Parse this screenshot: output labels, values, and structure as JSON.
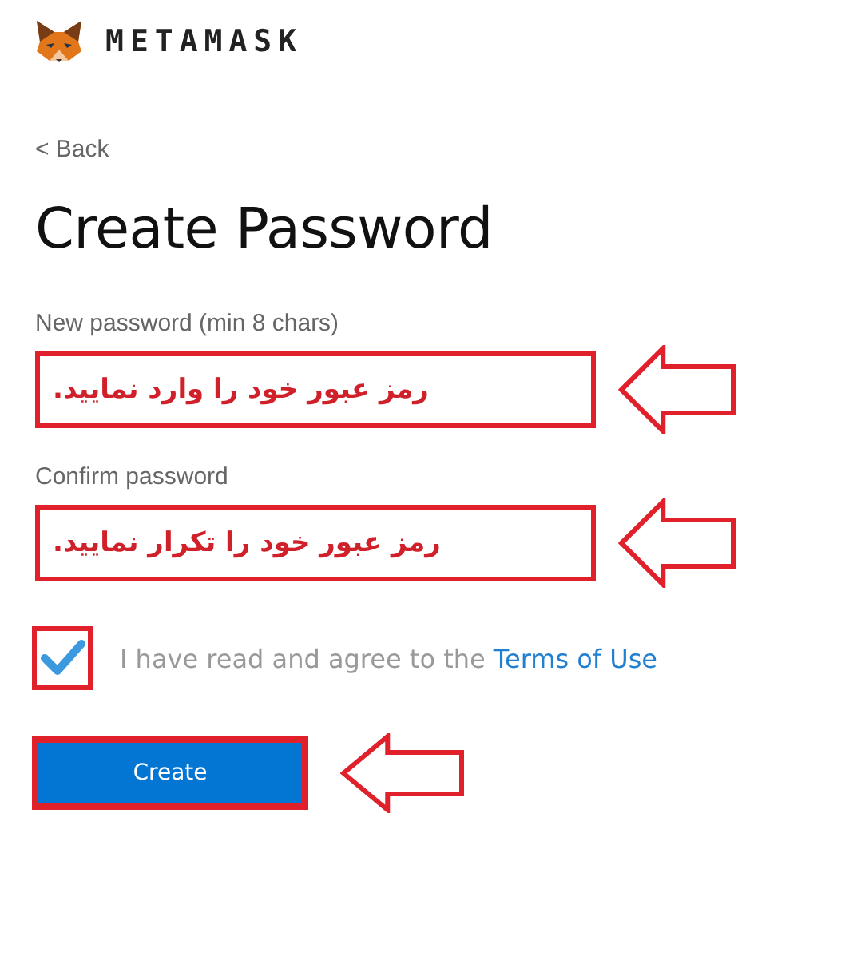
{
  "header": {
    "brand": "METAMASK"
  },
  "back_link": {
    "label": "< Back"
  },
  "title": "Create Password",
  "fields": [
    {
      "label": "New password (min 8 chars)",
      "value": "رمز عبور خود را وارد نمایید.",
      "highlighted": true,
      "arrow": true
    },
    {
      "label": "Confirm password",
      "value": "رمز عبور خود را تکرار نمایید.",
      "highlighted": true,
      "arrow": true
    }
  ],
  "agreement": {
    "checked": true,
    "highlighted": true,
    "text": "I have read and agree to the",
    "link": "Terms of Use"
  },
  "create_button": {
    "label": "Create",
    "highlighted": true,
    "arrow": true
  }
}
